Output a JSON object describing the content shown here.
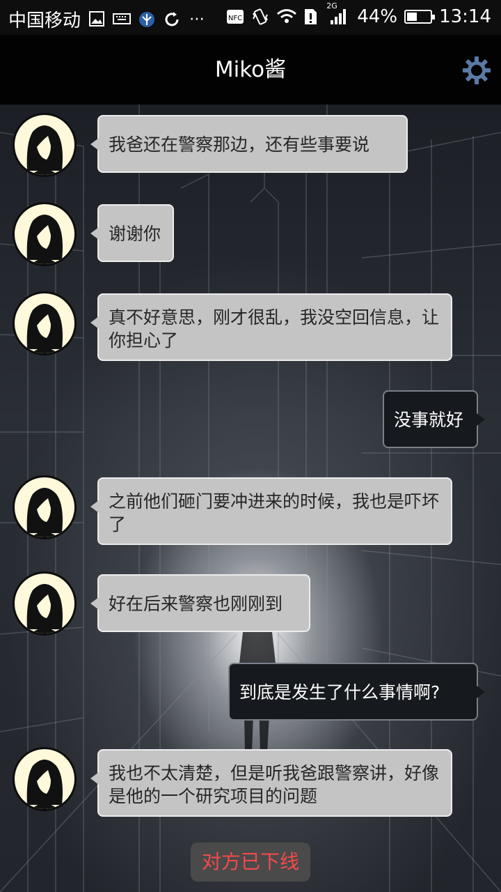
{
  "status_bar": {
    "carrier": "中国移动",
    "network_badge": "2G",
    "battery": "44%",
    "battery_level": 0.44,
    "time": "13:14",
    "icons": [
      "gallery-icon",
      "keyboard-icon",
      "wings-icon",
      "sync-icon",
      "more-icon",
      "nfc-icon",
      "vibrate-icon",
      "wifi-icon",
      "sim-alert-icon",
      "signal-icon",
      "battery-icon"
    ]
  },
  "header": {
    "title": "Miko酱",
    "settings_icon": "gear-icon"
  },
  "messages": [
    {
      "side": "left",
      "text": "我爸还在警察那边，还有些事要说"
    },
    {
      "side": "left",
      "text": "谢谢你"
    },
    {
      "side": "left",
      "text": "真不好意思，刚才很乱，我没空回信息，让你担心了"
    },
    {
      "side": "right",
      "text": "没事就好"
    },
    {
      "side": "left",
      "text": "之前他们砸门要冲进来的时候，我也是吓坏了"
    },
    {
      "side": "left",
      "text": "好在后来警察也刚刚到"
    },
    {
      "side": "right",
      "text": "到底是发生了什么事情啊?"
    },
    {
      "side": "left",
      "text": "我也不太清楚，但是听我爸跟警察讲，好像是他的一个研究项目的问题"
    }
  ],
  "status_notice": "对方已下线",
  "colors": {
    "left_bubble": "#c4c4c4",
    "right_bubble": "#16191d",
    "offline_text": "#f24b4b",
    "avatar_bg": "#fff9dc"
  }
}
